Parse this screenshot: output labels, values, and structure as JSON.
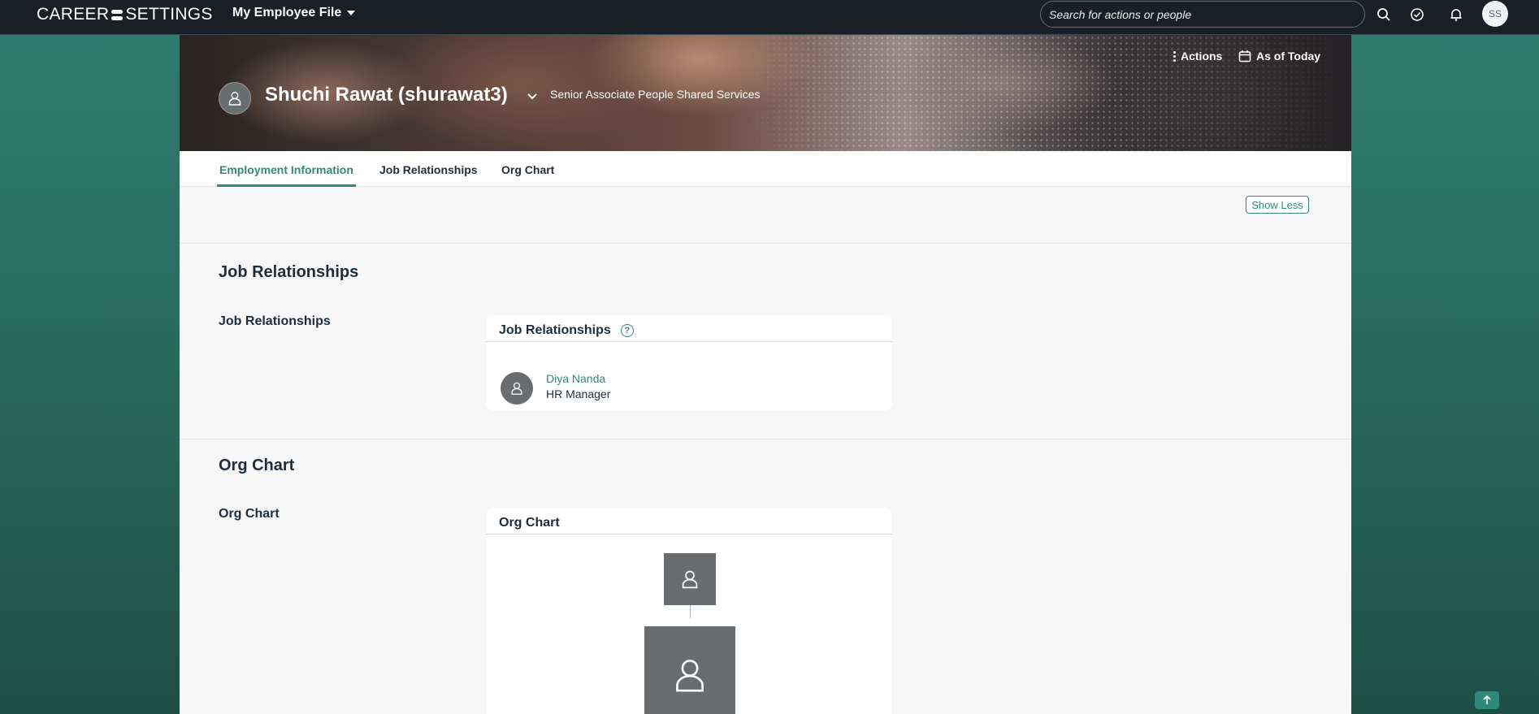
{
  "topbar": {
    "logo_left": "CAREER",
    "logo_right": "SETTINGS",
    "menu_title": "My Employee File",
    "search_placeholder": "Search for actions or people",
    "user_initials": "SS",
    "icons": [
      "search-icon",
      "approve-check-icon",
      "notification-bell-icon"
    ]
  },
  "header": {
    "name": "Shuchi Rawat (shurawat3)",
    "job_title": "Senior Associate People Shared Services",
    "actions_label": "Actions",
    "as_of_label": "As of Today"
  },
  "tabs": [
    {
      "label": "Employment Information",
      "active": true
    },
    {
      "label": "Job Relationships",
      "active": false
    },
    {
      "label": "Org Chart",
      "active": false
    }
  ],
  "show_less_label": "Show Less",
  "job_relationships": {
    "section_title": "Job Relationships",
    "field_label": "Job Relationships",
    "card_title": "Job Relationships",
    "help_glyph": "?",
    "person": {
      "name": "Diya Nanda",
      "role": "HR Manager"
    }
  },
  "org_chart": {
    "section_title": "Org Chart",
    "field_label": "Org Chart",
    "card_title": "Org Chart"
  },
  "colors": {
    "accent": "#2f8a7b",
    "topbar_bg": "#1a1f26",
    "page_bg": "#2a6e62"
  }
}
